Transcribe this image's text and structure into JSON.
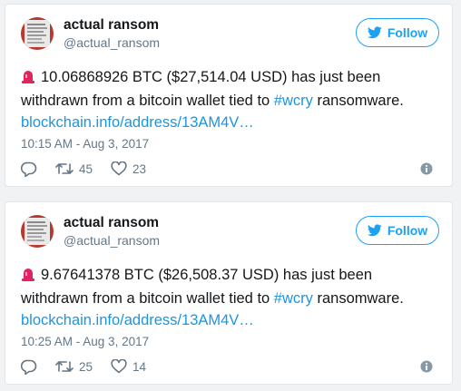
{
  "tweets": [
    {
      "author_name": "actual ransom",
      "author_handle": "@actual_ransom",
      "follow_label": "Follow",
      "text_main": "10.06868926 BTC ($27,514.04 USD) has just been withdrawn from a bitcoin wallet tied to ",
      "hashtag": "#wcry",
      "text_after": " ransomware.",
      "link": "blockchain.info/address/13AM4V…",
      "timestamp": "10:15 AM - Aug 3, 2017",
      "retweets": "45",
      "likes": "23"
    },
    {
      "author_name": "actual ransom",
      "author_handle": "@actual_ransom",
      "follow_label": "Follow",
      "text_main": "9.67641378 BTC ($26,508.37 USD) has just been withdrawn from a bitcoin wallet tied to ",
      "hashtag": "#wcry",
      "text_after": " ransomware.",
      "link": "blockchain.info/address/13AM4V…",
      "timestamp": "10:25 AM - Aug 3, 2017",
      "retweets": "25",
      "likes": "14"
    }
  ],
  "icons": {
    "avatar": "ransom-note-avatar",
    "siren": "police-light-icon",
    "follow": "twitter-bird-icon",
    "reply": "reply-icon",
    "retweet": "retweet-icon",
    "like": "heart-icon",
    "info": "info-icon"
  },
  "colors": {
    "accent": "#1da1f2",
    "link": "#1b95e0",
    "muted": "#657786",
    "text": "#14171a",
    "siren": "#e0245e"
  }
}
